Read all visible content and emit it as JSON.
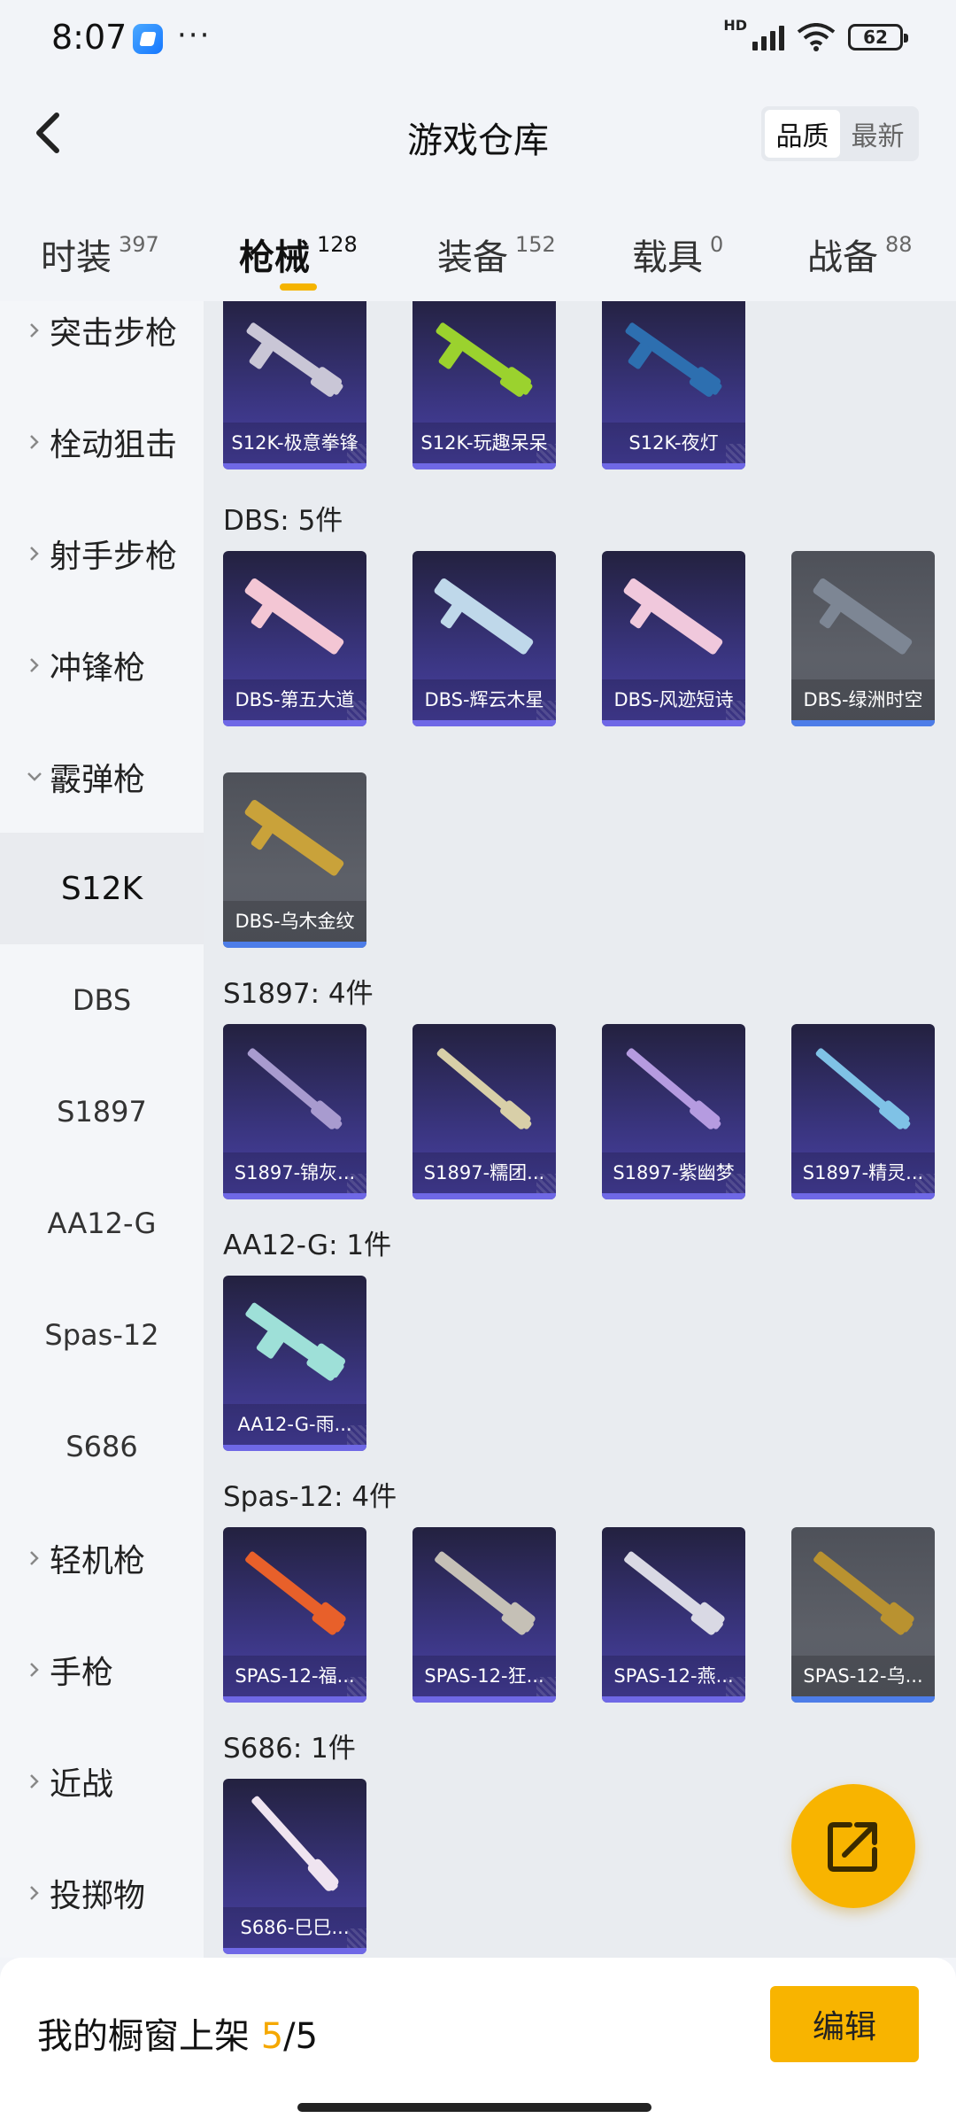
{
  "status_bar": {
    "time": "8:07",
    "more": "···",
    "network": "HD",
    "battery": "62"
  },
  "header": {
    "title": "游戏仓库",
    "sort_options": [
      "品质",
      "最新"
    ],
    "sort_selected": "品质"
  },
  "tabs": [
    {
      "label": "时装",
      "count": "397"
    },
    {
      "label": "枪械",
      "count": "128",
      "active": true
    },
    {
      "label": "装备",
      "count": "152"
    },
    {
      "label": "载具",
      "count": "0"
    },
    {
      "label": "战备",
      "count": "88"
    }
  ],
  "sidebar": {
    "items": [
      {
        "label": "突击步枪"
      },
      {
        "label": "栓动狙击"
      },
      {
        "label": "射手步枪"
      },
      {
        "label": "冲锋枪"
      },
      {
        "label": "霰弹枪",
        "expanded": true
      },
      {
        "label": "轻机枪"
      },
      {
        "label": "手枪"
      },
      {
        "label": "近战"
      },
      {
        "label": "投掷物"
      }
    ],
    "sub_items": [
      {
        "label": "S12K",
        "active": true
      },
      {
        "label": "DBS"
      },
      {
        "label": "S1897"
      },
      {
        "label": "AA12-G"
      },
      {
        "label": "Spas-12"
      },
      {
        "label": "S686"
      }
    ]
  },
  "content": {
    "s12k_cards": [
      {
        "name": "S12K-极意拳锋",
        "color": "#c9c6d6"
      },
      {
        "name": "S12K-玩趣呆呆",
        "color": "#9bd22e"
      },
      {
        "name": "S12K-夜灯",
        "color": "#2d6fb0"
      }
    ],
    "sections": [
      {
        "title": "DBS: 5件",
        "cards": [
          {
            "name": "DBS-第五大道",
            "color": "#f3c6d4"
          },
          {
            "name": "DBS-辉云木星",
            "color": "#bfd8ea"
          },
          {
            "name": "DBS-风迹短诗",
            "color": "#f0c8dc"
          },
          {
            "name": "DBS-绿洲时空",
            "color": "#7d8694",
            "gray": true
          },
          {
            "name": "DBS-乌木金纹",
            "color": "#c9a23a",
            "gray": true
          }
        ]
      },
      {
        "title": "S1897: 4件",
        "cards": [
          {
            "name": "S1897-锦灰...",
            "color": "#a89bcf"
          },
          {
            "name": "S1897-糯团...",
            "color": "#d8cfa8"
          },
          {
            "name": "S1897-紫幽梦",
            "color": "#b59be0"
          },
          {
            "name": "S1897-精灵...",
            "color": "#7fc2e6"
          }
        ]
      },
      {
        "title": "AA12-G: 1件",
        "cards": [
          {
            "name": "AA12-G-雨...",
            "color": "#9ee0d8"
          }
        ]
      },
      {
        "title": "Spas-12: 4件",
        "cards": [
          {
            "name": "SPAS-12-福...",
            "color": "#e8602a"
          },
          {
            "name": "SPAS-12-狂...",
            "color": "#c5c0b6"
          },
          {
            "name": "SPAS-12-燕...",
            "color": "#d9d9e4"
          },
          {
            "name": "SPAS-12-乌...",
            "color": "#b99230",
            "gray": true
          }
        ]
      },
      {
        "title": "S686: 1件",
        "cards": [
          {
            "name": "S686-巳巳...",
            "color": "#efe4f0"
          }
        ]
      }
    ]
  },
  "bottom": {
    "shelf_label": "我的橱窗上架",
    "shelf_current": "5",
    "shelf_total": "/5",
    "edit_label": "编辑"
  },
  "colors": {
    "accent": "#f8b400",
    "card_purple": "#3a3580",
    "card_gray": "#5d6068"
  }
}
